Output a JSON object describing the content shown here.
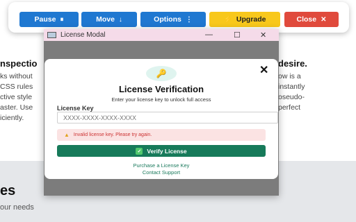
{
  "toolbar": {
    "pause_label": "Pause",
    "pause_icon": "⏸",
    "move_label": "Move",
    "move_icon": "↓",
    "options_label": "Options",
    "options_icon": "⋮",
    "upgrade_label": "Upgrade",
    "upgrade_icon": "⚡",
    "close_label": "Close",
    "close_icon": "✕"
  },
  "background": {
    "left_heading": "nspectio",
    "left_lines": [
      "ks without",
      "CSS rules",
      "ctive style",
      "aster. Use",
      "iciently."
    ],
    "right_heading": "desire.",
    "right_lines": [
      "ow is a",
      "instantly",
      "oseudo-",
      "perfect"
    ],
    "lower_title": "es",
    "lower_sub": "our needs"
  },
  "window": {
    "title": "License Modal",
    "min_icon": "—",
    "max_icon": "☐",
    "close_icon": "✕"
  },
  "modal": {
    "key_icon": "🔑",
    "close_icon": "✕",
    "title": "License Verification",
    "subtitle": "Enter your license key to unlock full access",
    "field_label": "License Key",
    "input_placeholder": "XXXX-XXXX-XXXX-XXXX",
    "warning_icon": "▲",
    "error_text": "Invalid license key. Please try again.",
    "verify_label": "Verify License",
    "check_icon": "✓",
    "purchase_link": "Purchase a License Key",
    "support_link": "Contact Support"
  }
}
